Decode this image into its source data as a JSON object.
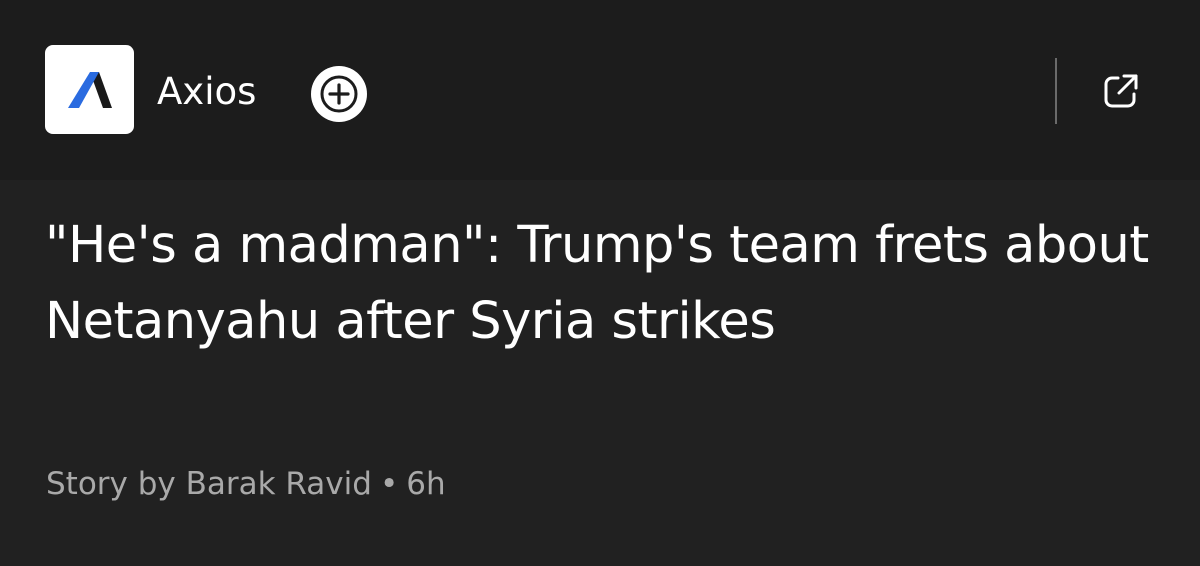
{
  "source": {
    "name": "Axios",
    "logo_icon": "axios-logo",
    "logo_colors": {
      "dark": "#1a1a1a",
      "accent": "#2a6be0"
    }
  },
  "actions": {
    "follow_icon": "plus-icon",
    "open_icon": "external-link-icon"
  },
  "article": {
    "headline": "\"He's a madman\": Trump's team frets about Netanyahu after Syria strikes",
    "byline": "Story by Barak Ravid",
    "separator": "•",
    "time": "6h"
  },
  "colors": {
    "background": "#212121",
    "header_background": "#1c1c1c",
    "text": "#ffffff",
    "muted_text": "#a9a9a9"
  }
}
